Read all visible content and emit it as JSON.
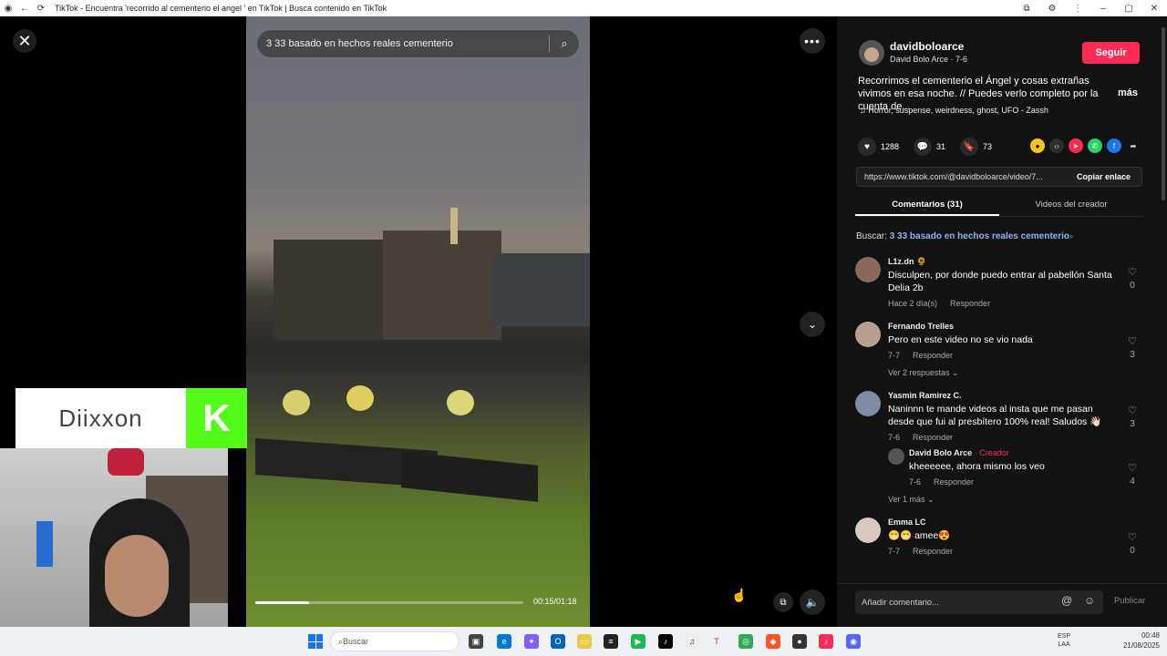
{
  "window": {
    "title": "TikTok - Encuentra 'recorrido al cementerio el angel ' en TikTok | Busca contenido en TikTok"
  },
  "video": {
    "search_query": "3 33 basado en hechos reales cementerio",
    "progress_fraction": 0.2,
    "time": "00:15/01:18"
  },
  "overlay": {
    "brand_name": "Diixxon",
    "brand_logo_letter": "K",
    "brand_color": "#53fc18"
  },
  "post": {
    "username": "davidboloarce",
    "display_name": "David Bolo Arce · 7-6",
    "follow_label": "Seguir",
    "description": "Recorrimos el cementerio el Ángel y cosas extrañas vivimos en esa noche. // Puedes verlo completo por la cuenta de...",
    "more_label": "más",
    "music": "Horror, suspense, weirdness, ghost, UFO - Zassh",
    "likes": "1288",
    "comments_count": "31",
    "saves": "73",
    "url": "https://www.tiktok.com/@davidboloarce/video/7...",
    "copy_label": "Copiar enlace"
  },
  "tabs": {
    "comments": "Comentarios (31)",
    "creator_videos": "Videos del creador"
  },
  "search_label": {
    "prefix": "Buscar:",
    "query": "3 33 basado en hechos reales cementerio"
  },
  "comments": [
    {
      "name": "L1z.dn 🌻",
      "text": "Disculpen, por donde puedo entrar al pabellón Santa Delia 2b",
      "date": "Hace 2 día(s)",
      "reply": "Responder",
      "likes": "0"
    },
    {
      "name": "Fernando Trelles",
      "text": "Pero en este video no se vio nada",
      "date": "7-7",
      "reply": "Responder",
      "likes": "3",
      "view_replies": "Ver 2 respuestas ⌄"
    },
    {
      "name": "Yasmin Ramirez C.",
      "text": "Naninnn te mande videos al insta que me pasan desde que fui al presbítero 100% real! Saludos 👋🏻",
      "date": "7-6",
      "reply": "Responder",
      "likes": "3"
    },
    {
      "name": "David Bolo Arce",
      "creator": "· Creador",
      "text": "kheeeeee, ahora mismo los veo",
      "date": "7-6",
      "reply": "Responder",
      "likes": "4",
      "view_more": "Ver 1 más ⌄"
    },
    {
      "name": "Emma LC",
      "text": "😁😁 amee😍",
      "date": "7-7",
      "reply": "Responder",
      "likes": "0"
    }
  ],
  "comment_input": {
    "placeholder": "Añadir comentario...",
    "publish": "Publicar"
  },
  "taskbar": {
    "search": "Buscar",
    "lang": "ESP\nLAA",
    "time": "00:48",
    "date": "21/08/2025"
  },
  "colors": {
    "accent": "#fe2c55",
    "link": "#8ab4f8",
    "panel_bg": "#121212"
  }
}
